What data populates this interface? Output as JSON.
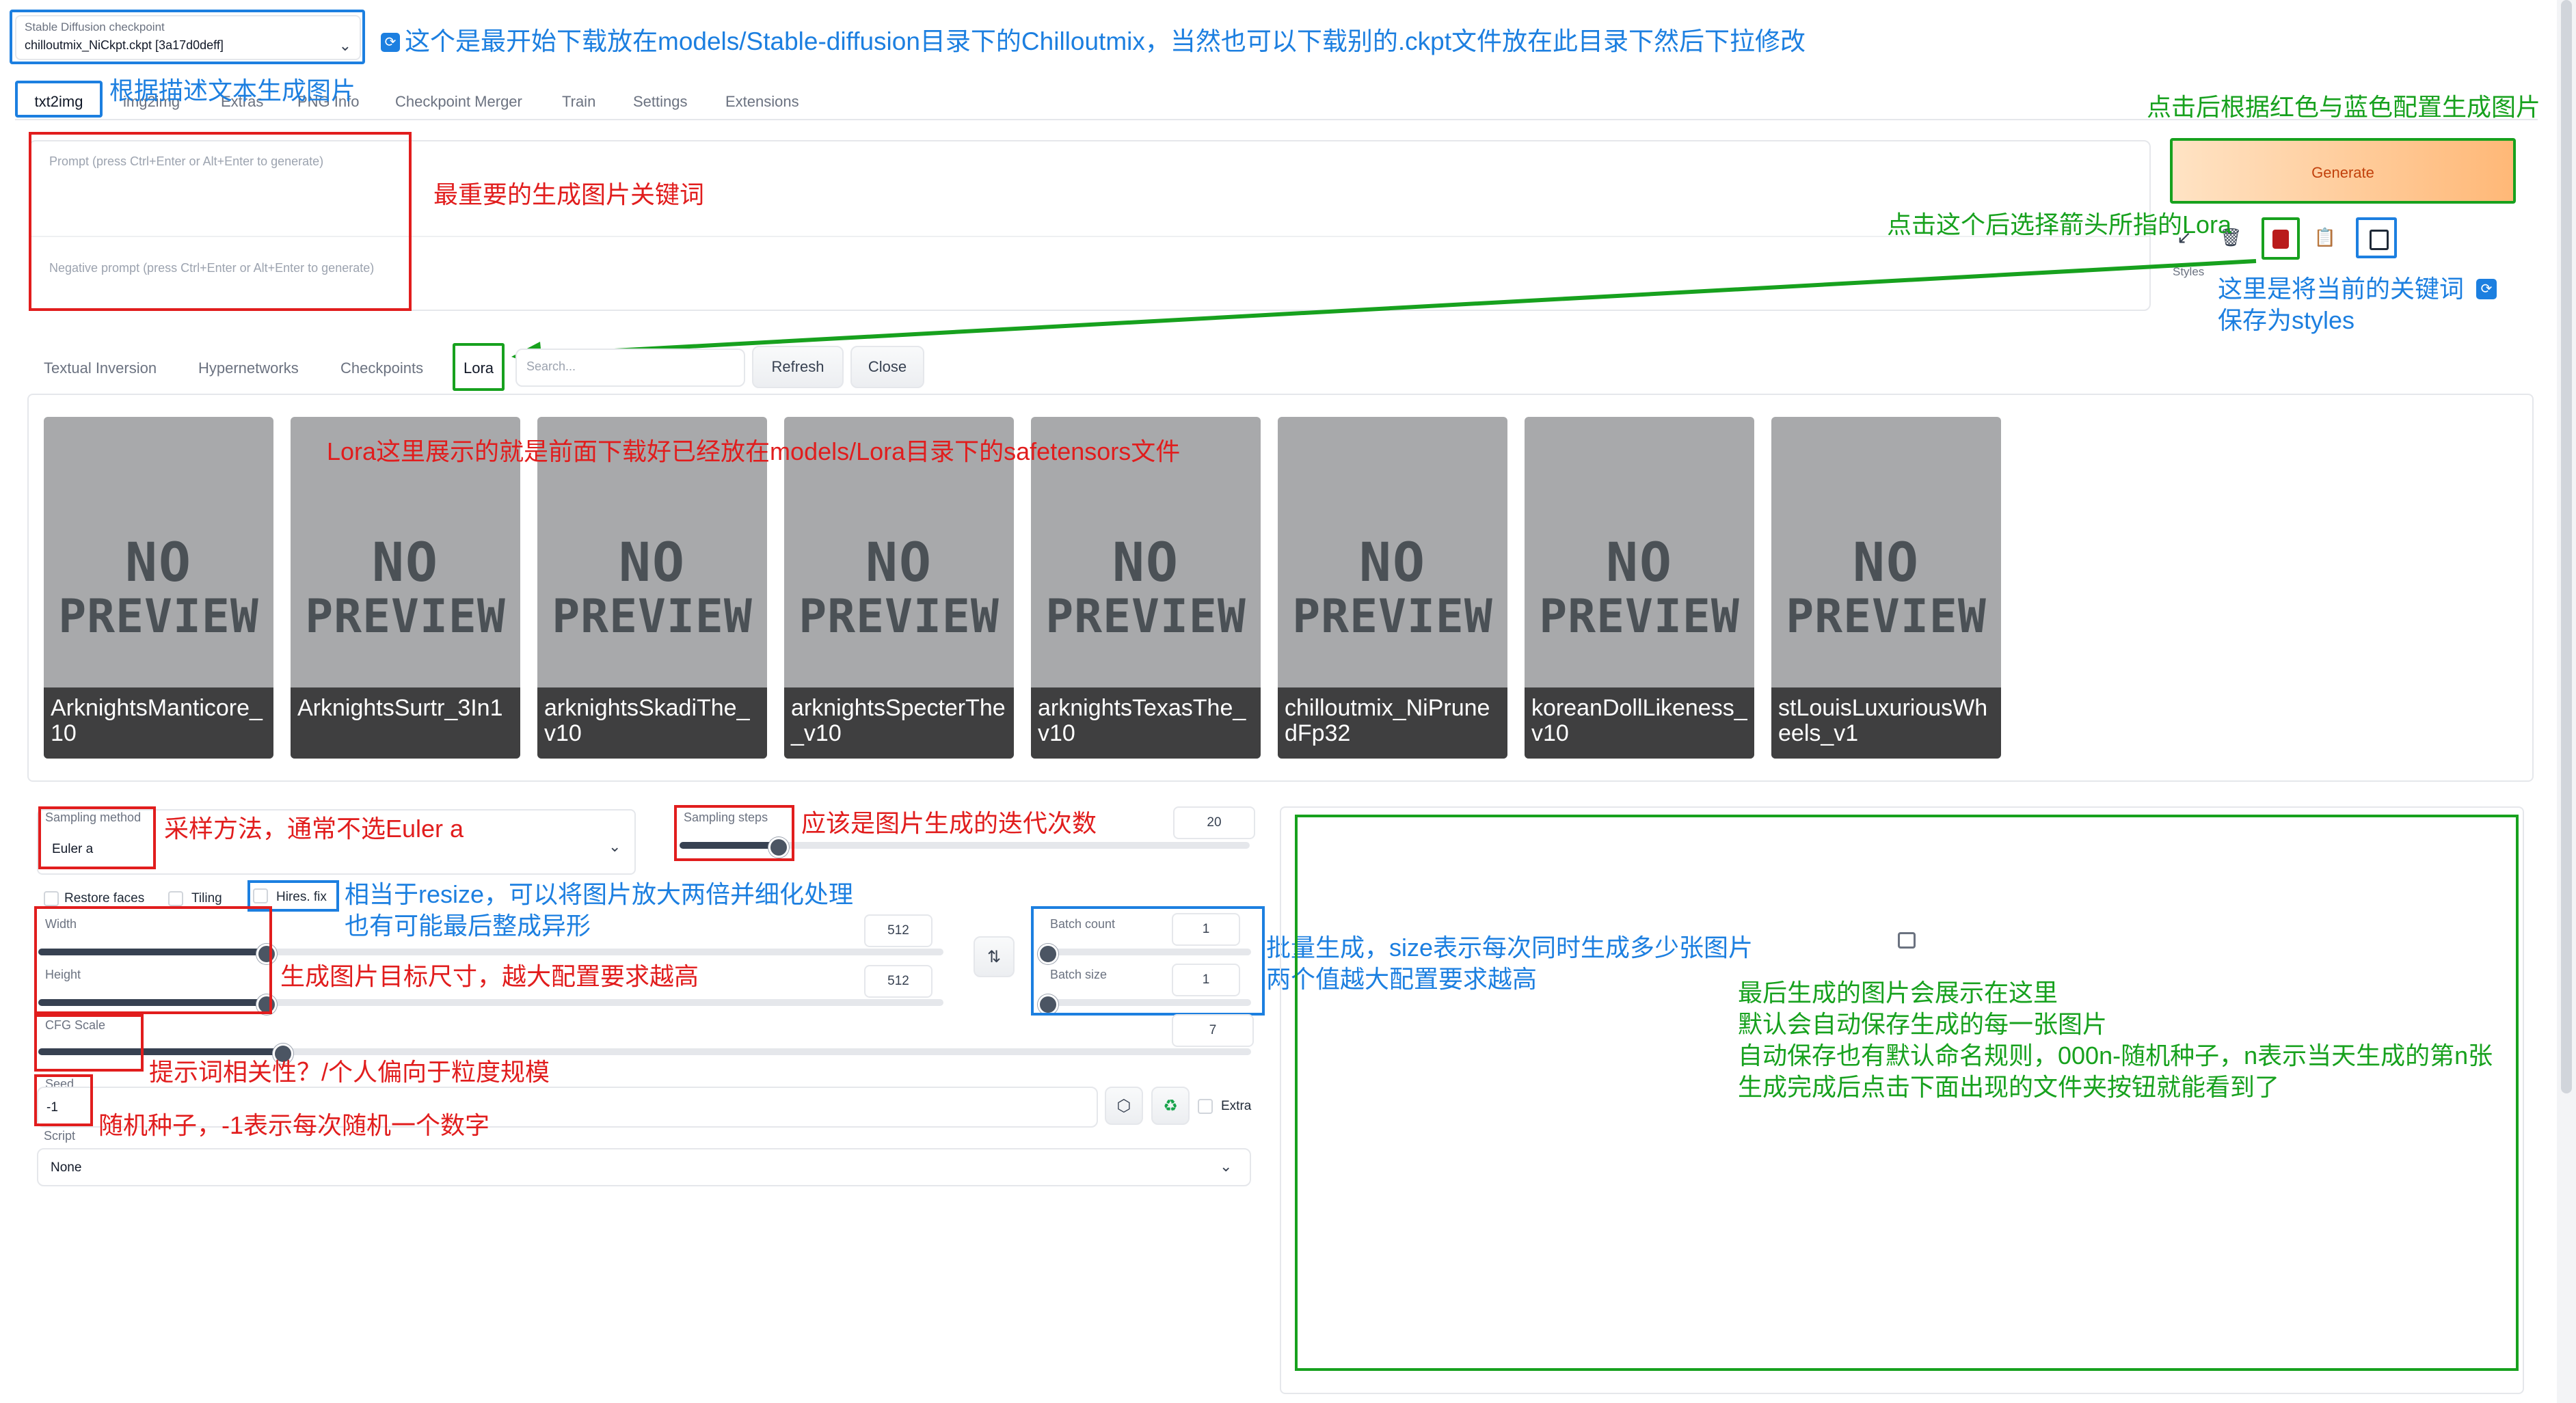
{
  "checkpoint": {
    "label": "Stable Diffusion checkpoint",
    "value": "chilloutmix_NiCkpt.ckpt [3a17d0deff]"
  },
  "tabs": [
    "txt2img",
    "img2img",
    "Extras",
    "PNG Info",
    "Checkpoint Merger",
    "Train",
    "Settings",
    "Extensions"
  ],
  "prompt": {
    "positive_placeholder": "Prompt (press Ctrl+Enter or Alt+Enter to generate)",
    "negative_placeholder": "Negative prompt (press Ctrl+Enter or Alt+Enter to generate)"
  },
  "generate_label": "Generate",
  "styles_label": "Styles",
  "extra_networks": {
    "tabs": [
      "Textual Inversion",
      "Hypernetworks",
      "Checkpoints",
      "Lora"
    ],
    "search_placeholder": "Search...",
    "refresh_label": "Refresh",
    "close_label": "Close",
    "preview_line1": "NO",
    "preview_line2": "PREVIEW",
    "cards": [
      "ArknightsManticore_10",
      "ArknightsSurtr_3In1",
      "arknightsSkadiThe_v10",
      "arknightsSpecterThe_v10",
      "arknightsTexasThe_v10",
      "chilloutmix_NiPrunedFp32",
      "koreanDollLikeness_v10",
      "stLouisLuxuriousWheels_v1"
    ]
  },
  "settings": {
    "sampling_method_label": "Sampling method",
    "sampling_method_value": "Euler a",
    "sampling_steps_label": "Sampling steps",
    "sampling_steps_value": "20",
    "restore_faces_label": "Restore faces",
    "tiling_label": "Tiling",
    "hires_fix_label": "Hires. fix",
    "width_label": "Width",
    "width_value": "512",
    "height_label": "Height",
    "height_value": "512",
    "batch_count_label": "Batch count",
    "batch_count_value": "1",
    "batch_size_label": "Batch size",
    "batch_size_value": "1",
    "cfg_scale_label": "CFG Scale",
    "cfg_scale_value": "7",
    "seed_label": "Seed",
    "seed_value": "-1",
    "extra_label": "Extra",
    "script_label": "Script",
    "script_value": "None"
  },
  "slider_levels": {
    "sampling_steps": 0.17,
    "width": 0.25,
    "height": 0.25,
    "batch_count": 0.0,
    "batch_size": 0.0,
    "cfg_scale": 0.2
  },
  "annotations": {
    "checkpoint_note": "这个是最开始下载放在models/Stable-diffusion目录下的Chilloutmix，当然也可以下载别的.ckpt文件放在此目录下然后下拉修改",
    "txt2img_note": "根据描述文本生成图片",
    "generate_note": "点击后根据红色与蓝色配置生成图片",
    "prompt_note": "最重要的生成图片关键词",
    "lora_button_note": "点击这个后选择箭头所指的Lora",
    "styles_note_1": "这里是将当前的关键词",
    "styles_note_2": "保存为styles",
    "lora_list_note": "Lora这里展示的就是前面下载好已经放在models/Lora目录下的safetensors文件",
    "sampler_note": "采样方法，通常不选Euler a",
    "steps_note": "应该是图片生成的迭代次数",
    "hires_note_1": "相当于resize，可以将图片放大两倍并细化处理",
    "hires_note_2": "也有可能最后整成异形",
    "size_note": "生成图片目标尺寸，越大配置要求越高",
    "batch_note_1": "批量生成，size表示每次同时生成多少张图片",
    "batch_note_2": "两个值越大配置要求越高",
    "cfg_note": "提示词相关性？/个人偏向于粒度规模",
    "seed_note": "随机种子，-1表示每次随机一个数字",
    "output_note_1": "最后生成的图片会展示在这里",
    "output_note_2": "默认会自动保存生成的每一张图片",
    "output_note_3": "自动保存也有默认命名规则，000n-随机种子，n表示当天生成的第n张",
    "output_note_4": "生成完成后点击下面出现的文件夹按钮就能看到了"
  },
  "colors": {
    "annotation_red": "#e11d1d",
    "annotation_blue": "#1c7fe0",
    "annotation_green": "#17a11e",
    "generate_gradient_start": "#ffd9b0",
    "generate_gradient_end": "#ffb877"
  }
}
